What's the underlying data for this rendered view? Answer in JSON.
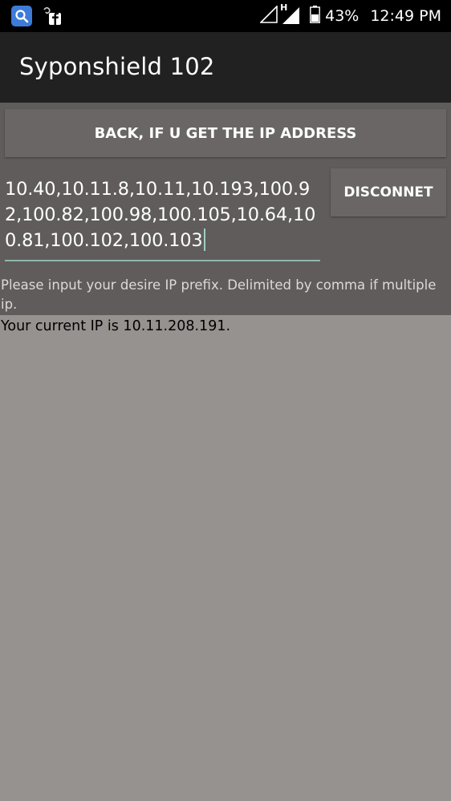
{
  "status_bar": {
    "battery_pct": "43%",
    "time": "12:49 PM",
    "network_type": "H",
    "icons": [
      "search-app-icon",
      "notification-facebook-icon",
      "signal-empty-icon",
      "signal-h-icon",
      "battery-icon"
    ]
  },
  "app": {
    "title": "Syponshield 102"
  },
  "main": {
    "back_button_label": "BACK, IF U GET THE IP ADDRESS",
    "ip_prefix_value": "10.40,10.11.8,10.11,10.193,100.92,100.82,100.98,100.105,10.64,100.81,100.102,100.103",
    "disconnect_label": "DISCONNET",
    "hint": "Please input your desire IP prefix. Delimited by comma if multiple ip.",
    "current_ip": "Your current IP is 10.11.208.191."
  },
  "colors": {
    "app_bar": "#212121",
    "panel": "#5f5c5b",
    "background": "#969290",
    "accent": "#8fb6ae"
  }
}
